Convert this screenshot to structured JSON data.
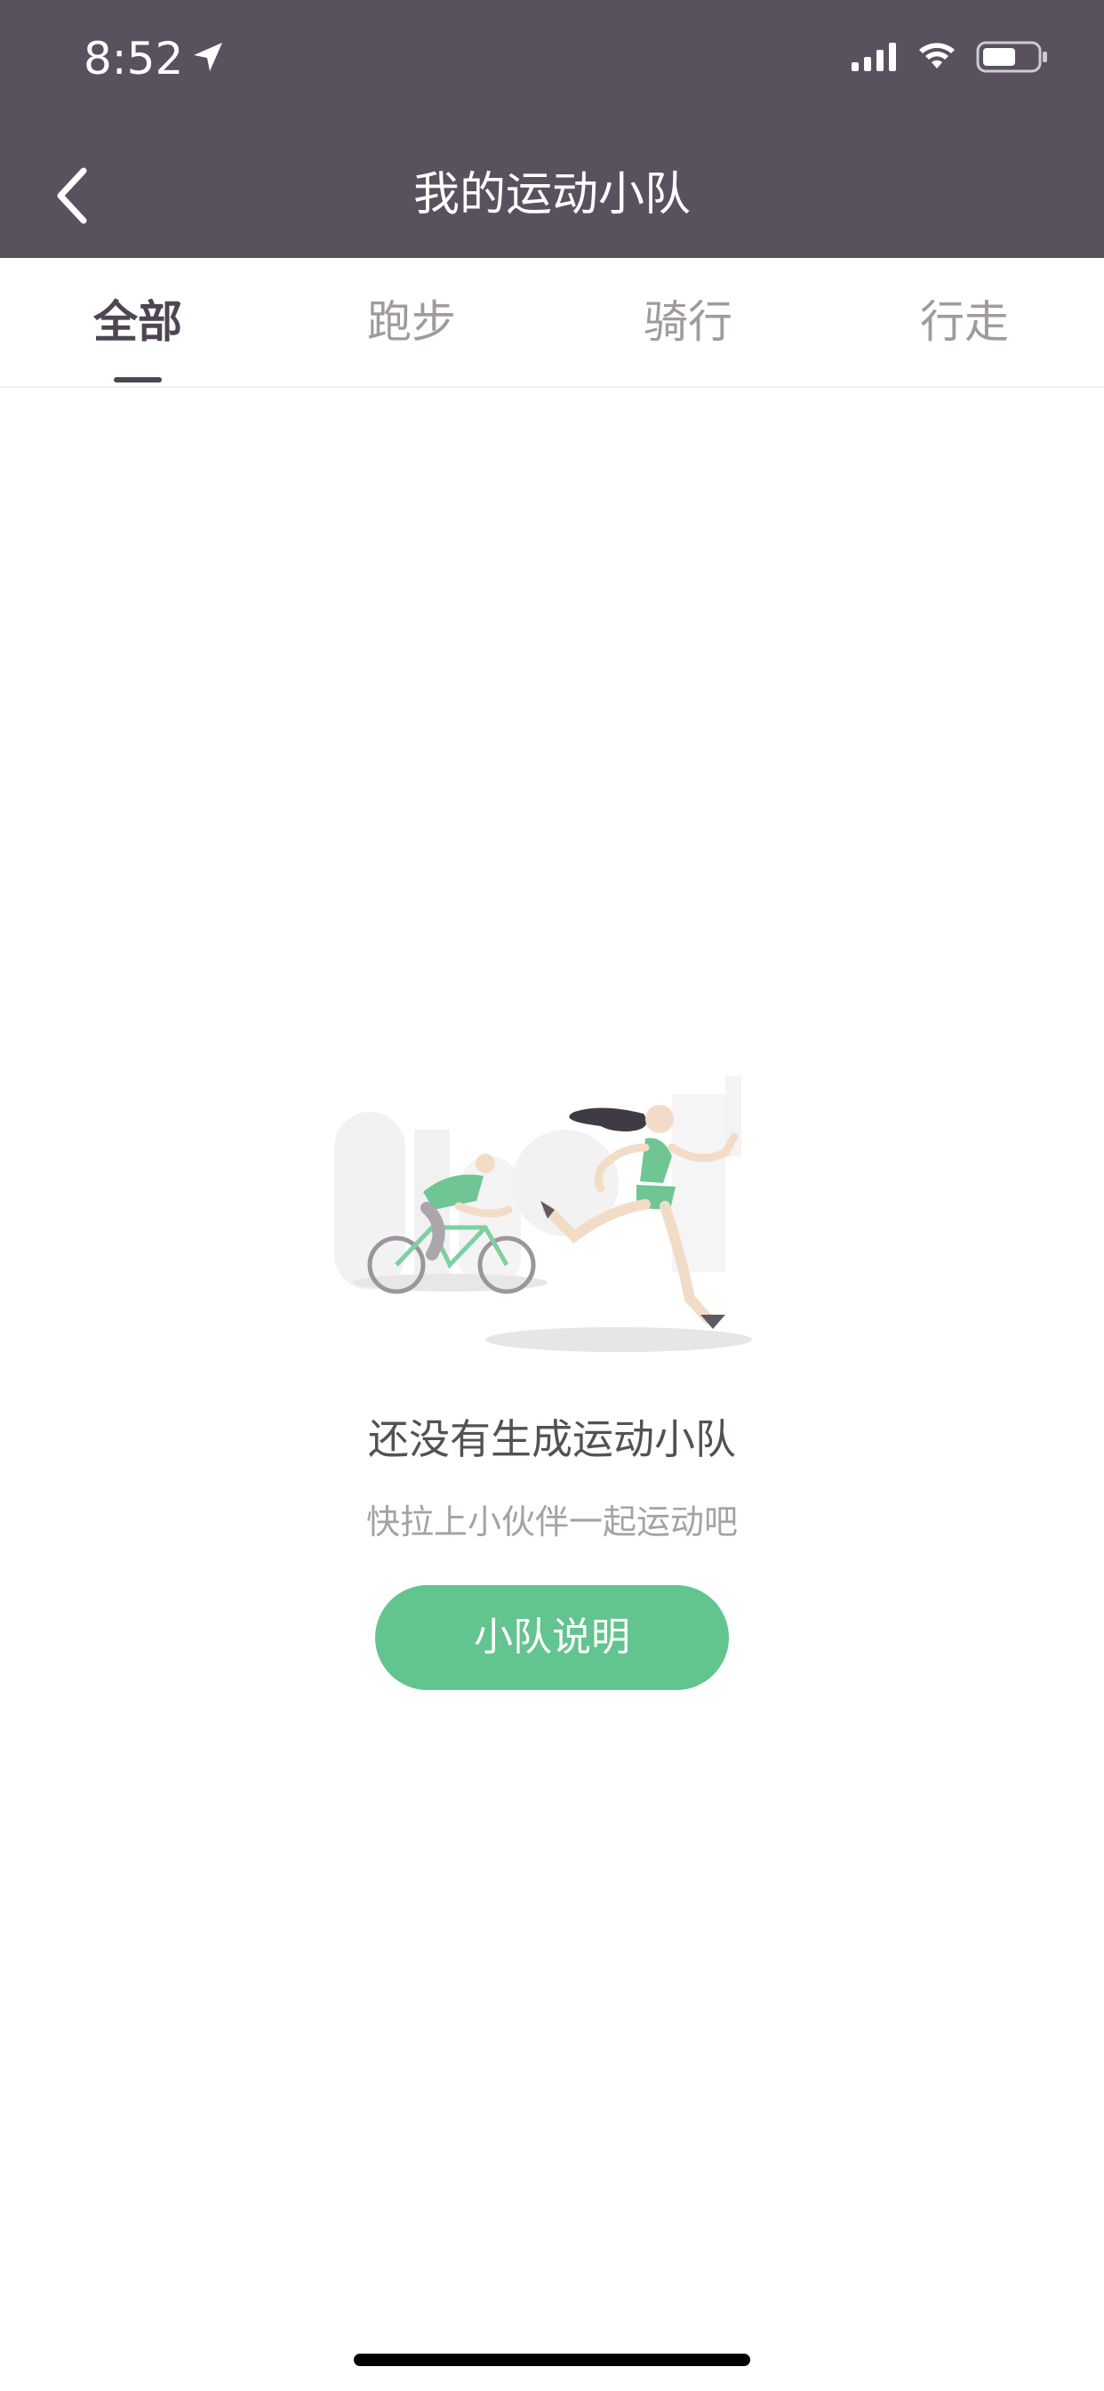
{
  "status_bar": {
    "time": "8:52",
    "icons": [
      "location-arrow-icon",
      "signal-icon",
      "wifi-icon",
      "battery-icon"
    ]
  },
  "nav": {
    "title": "我的运动小队",
    "back_icon": "chevron-left-icon"
  },
  "tabs": [
    {
      "label": "全部",
      "active": true
    },
    {
      "label": "跑步",
      "active": false
    },
    {
      "label": "骑行",
      "active": false
    },
    {
      "label": "行走",
      "active": false
    }
  ],
  "empty_state": {
    "illustration": "cyclist-and-runner-illustration",
    "title": "还没有生成运动小队",
    "subtitle": "快拉上小伙伴一起运动吧",
    "button_label": "小队说明"
  },
  "colors": {
    "header_bg": "#5a515f",
    "accent_green": "#62c48e",
    "active_tab": "#4d4652",
    "inactive_tab": "#a09aa0"
  }
}
